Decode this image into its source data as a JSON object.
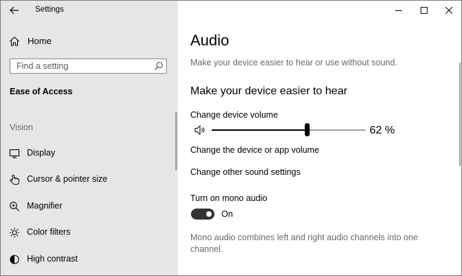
{
  "window": {
    "app_title": "Settings"
  },
  "sidebar": {
    "home_label": "Home",
    "search_placeholder": "Find a setting",
    "section_title": "Ease of Access",
    "group_label": "Vision",
    "items": [
      {
        "label": "Display",
        "icon": "monitor-icon"
      },
      {
        "label": "Cursor & pointer size",
        "icon": "pointer-hand-icon"
      },
      {
        "label": "Magnifier",
        "icon": "magnifier-icon"
      },
      {
        "label": "Color filters",
        "icon": "sun-icon"
      },
      {
        "label": "High contrast",
        "icon": "contrast-icon"
      }
    ]
  },
  "main": {
    "title": "Audio",
    "subtitle": "Make your device easier to hear or use without sound.",
    "section_heading": "Make your device easier to hear",
    "volume": {
      "label": "Change device volume",
      "value": 62,
      "value_text": "62 %",
      "icon": "speaker-icon"
    },
    "links": {
      "device_app_volume": "Change the device or app volume",
      "other_sound": "Change other sound settings"
    },
    "mono": {
      "label": "Turn on mono audio",
      "toggle_on": true,
      "state_text": "On",
      "description": "Mono audio combines left and right audio channels into one channel."
    }
  },
  "colors": {
    "sidebar_bg": "#e6e6e6",
    "accent_dark": "#333333",
    "secondary_text": "#6a6a6a"
  }
}
